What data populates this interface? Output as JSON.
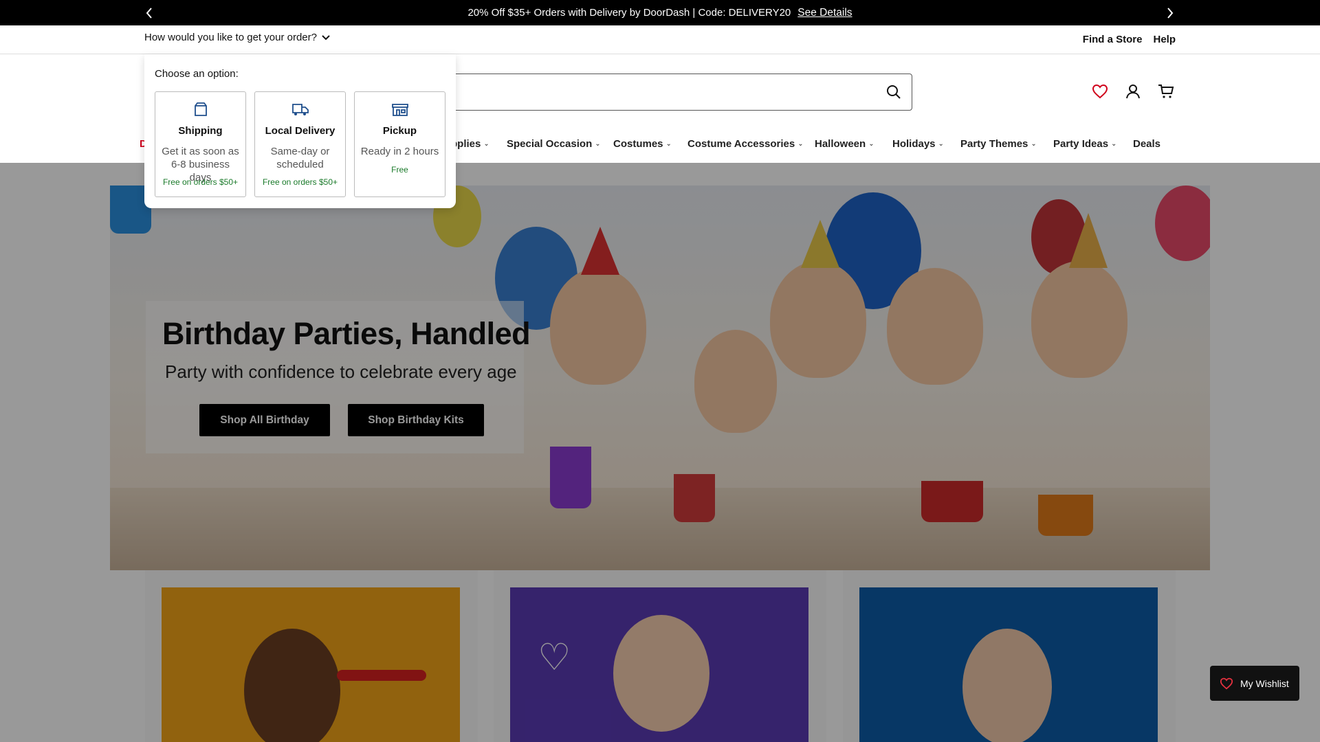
{
  "promo": {
    "message": "20% Off $35+ Orders with Delivery by DoorDash | Code: DELIVERY20",
    "link": "See Details"
  },
  "utility": {
    "order_prompt": "How would you like to get your order?",
    "find_store": "Find a Store",
    "help": "Help"
  },
  "search": {
    "placeholder": "",
    "value": ""
  },
  "nav": {
    "items": [
      {
        "label": "D"
      },
      {
        "label": "pplies"
      },
      {
        "label": "Special Occasion"
      },
      {
        "label": "Costumes"
      },
      {
        "label": "Costume Accessories"
      },
      {
        "label": "Halloween"
      },
      {
        "label": "Holidays"
      },
      {
        "label": "Party Themes"
      },
      {
        "label": "Party Ideas"
      },
      {
        "label": "Deals"
      }
    ]
  },
  "popup": {
    "title": "Choose an option:",
    "options": [
      {
        "title": "Shipping",
        "desc": "Get it as soon as 6-8 business days",
        "foot": "Free on orders $50+",
        "icon": "box-icon"
      },
      {
        "title": "Local Delivery",
        "desc": "Same-day or scheduled",
        "foot": "Free on orders $50+",
        "icon": "truck-icon"
      },
      {
        "title": "Pickup",
        "desc": "Ready in 2 hours",
        "foot": "Free",
        "icon": "store-icon"
      }
    ]
  },
  "hero": {
    "title": "Birthday Parties, Handled",
    "subtitle": "Party with confidence to celebrate every age",
    "btn1": "Shop All Birthday",
    "btn2": "Shop Birthday Kits"
  },
  "wishlist": {
    "label": "My Wishlist"
  },
  "colors": {
    "accent": "#d0021b",
    "popup_icon": "#1e4e8c",
    "free_text": "#1a7a2a"
  }
}
